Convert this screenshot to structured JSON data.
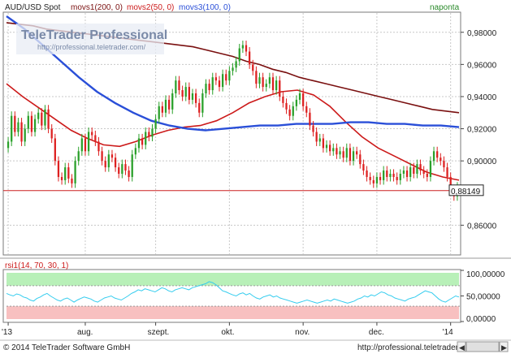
{
  "header": {
    "title": "AUD/USD Spot",
    "mov1": "movs1(200, 0)",
    "mov2": "movs2(50, 0)",
    "mov3": "movs3(100, 0)",
    "period": "naponta"
  },
  "watermark": {
    "brand": "TeleTrader Professional",
    "url": "http://professional.teletrader.com/"
  },
  "footer": {
    "copyright": "© 2014 TeleTrader Software GmbH",
    "url": "http://professional.teletrader.com"
  },
  "colors": {
    "up": "#2aa02a",
    "down": "#dd2020",
    "mov1": "#7a1010",
    "mov2": "#cc1a1a",
    "mov3": "#2a4fd8",
    "rsi": "#33ccee",
    "grid": "#c8c8c8",
    "last": "#cc2020"
  },
  "chart_data": [
    {
      "type": "candlestick",
      "ylim": [
        0.842,
        0.992
      ],
      "y_ticks": [
        "0,98000",
        "0,96000",
        "0,94000",
        "0,92000",
        "0,90000",
        "0,86000"
      ],
      "y_tick_values": [
        0.98,
        0.96,
        0.94,
        0.92,
        0.9,
        0.86
      ],
      "x_ticks": [
        "'13",
        "aug.",
        "szept.",
        "okt.",
        "nov.",
        "dec.",
        "'14"
      ],
      "x_tick_positions": [
        0,
        23,
        44,
        66,
        88,
        110,
        132
      ],
      "last_value": 0.88149,
      "last_label": "0,88149",
      "closes": [
        0.912,
        0.928,
        0.918,
        0.924,
        0.912,
        0.92,
        0.928,
        0.918,
        0.926,
        0.93,
        0.922,
        0.932,
        0.92,
        0.914,
        0.9,
        0.89,
        0.888,
        0.896,
        0.889,
        0.886,
        0.9,
        0.906,
        0.914,
        0.906,
        0.918,
        0.916,
        0.912,
        0.906,
        0.9,
        0.896,
        0.904,
        0.902,
        0.896,
        0.892,
        0.898,
        0.894,
        0.89,
        0.904,
        0.908,
        0.914,
        0.91,
        0.918,
        0.915,
        0.92,
        0.926,
        0.934,
        0.93,
        0.938,
        0.932,
        0.942,
        0.95,
        0.944,
        0.94,
        0.946,
        0.938,
        0.942,
        0.936,
        0.93,
        0.942,
        0.948,
        0.944,
        0.952,
        0.95,
        0.946,
        0.954,
        0.95,
        0.956,
        0.958,
        0.962,
        0.97,
        0.972,
        0.968,
        0.96,
        0.956,
        0.948,
        0.952,
        0.946,
        0.948,
        0.952,
        0.944,
        0.95,
        0.94,
        0.936,
        0.932,
        0.928,
        0.934,
        0.938,
        0.942,
        0.934,
        0.93,
        0.922,
        0.918,
        0.912,
        0.914,
        0.908,
        0.91,
        0.906,
        0.908,
        0.904,
        0.906,
        0.902,
        0.908,
        0.9,
        0.906,
        0.904,
        0.898,
        0.894,
        0.89,
        0.888,
        0.886,
        0.89,
        0.888,
        0.894,
        0.89,
        0.892,
        0.89,
        0.888,
        0.892,
        0.894,
        0.89,
        0.896,
        0.892,
        0.898,
        0.894,
        0.892,
        0.89,
        0.9,
        0.906,
        0.902,
        0.9,
        0.896,
        0.89,
        0.882,
        0.878,
        0.884
      ],
      "mov1_200": [
        0.986,
        0.985,
        0.984,
        0.982,
        0.981,
        0.98,
        0.979,
        0.978,
        0.977,
        0.976,
        0.975,
        0.974,
        0.973,
        0.972,
        0.971,
        0.969,
        0.967,
        0.965,
        0.962,
        0.96,
        0.957,
        0.955,
        0.952,
        0.95,
        0.948,
        0.946,
        0.944,
        0.942,
        0.94,
        0.938,
        0.936,
        0.934,
        0.932,
        0.931,
        0.93
      ],
      "mov2_50": [
        0.948,
        0.94,
        0.933,
        0.926,
        0.919,
        0.914,
        0.91,
        0.909,
        0.912,
        0.916,
        0.919,
        0.921,
        0.922,
        0.925,
        0.93,
        0.936,
        0.94,
        0.943,
        0.944,
        0.941,
        0.934,
        0.924,
        0.915,
        0.908,
        0.903,
        0.898,
        0.893,
        0.89,
        0.888
      ],
      "mov3_100": [
        0.99,
        0.982,
        0.972,
        0.962,
        0.952,
        0.943,
        0.936,
        0.93,
        0.925,
        0.922,
        0.92,
        0.919,
        0.92,
        0.921,
        0.922,
        0.922,
        0.923,
        0.923,
        0.923,
        0.924,
        0.924,
        0.923,
        0.923,
        0.922,
        0.922,
        0.921
      ]
    },
    {
      "type": "line",
      "title": "rsi1(14, 70, 30, 1)",
      "ylim": [
        0,
        100
      ],
      "y_ticks": [
        "100,00000",
        "50,00000",
        "0,00000"
      ],
      "y_tick_values": [
        100,
        50,
        0
      ],
      "bands": {
        "upper": [
          70,
          100
        ],
        "lower": [
          0,
          30
        ]
      },
      "values": [
        55,
        52,
        50,
        54,
        52,
        48,
        46,
        42,
        40,
        45,
        48,
        52,
        55,
        50,
        46,
        42,
        40,
        44,
        46,
        42,
        38,
        42,
        45,
        48,
        46,
        44,
        40,
        38,
        42,
        46,
        48,
        50,
        46,
        44,
        42,
        46,
        50,
        55,
        58,
        62,
        60,
        64,
        62,
        60,
        58,
        62,
        66,
        64,
        60,
        58,
        62,
        64,
        66,
        64,
        62,
        66,
        68,
        70,
        72,
        74,
        78,
        76,
        72,
        66,
        60,
        58,
        55,
        52,
        50,
        54,
        56,
        52,
        55,
        50,
        46,
        44,
        48,
        50,
        52,
        48,
        50,
        46,
        44,
        42,
        40,
        38,
        36,
        38,
        40,
        42,
        40,
        38,
        36,
        38,
        40,
        42,
        40,
        44,
        42,
        40,
        38,
        36,
        38,
        40,
        44,
        46,
        50,
        48,
        52,
        50,
        54,
        58,
        56,
        52,
        50,
        46,
        44,
        42,
        40,
        44,
        46,
        48,
        52,
        56,
        60,
        58,
        56,
        50,
        44,
        40,
        38,
        42,
        46,
        50,
        48
      ]
    }
  ]
}
